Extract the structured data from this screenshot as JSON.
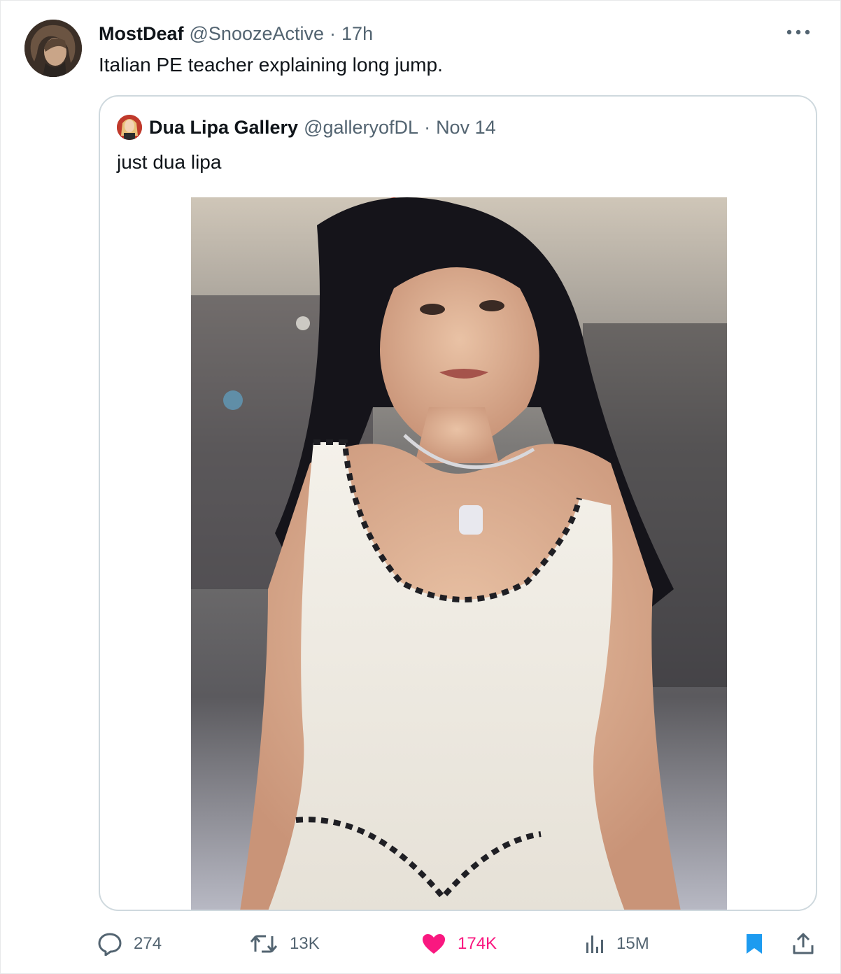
{
  "tweet": {
    "display_name": "MostDeaf",
    "handle": "@SnoozeActive",
    "separator": "·",
    "time": "17h",
    "text": "Italian PE teacher explaining long jump."
  },
  "quoted_tweet": {
    "display_name": "Dua Lipa Gallery",
    "handle": "@galleryofDL",
    "separator": "·",
    "time": "Nov 14",
    "text": "just dua lipa"
  },
  "actions": {
    "replies": "274",
    "retweets": "13K",
    "likes": "174K",
    "views": "15M"
  },
  "colors": {
    "like_active": "#f91880",
    "bookmark_active": "#1d9bf0",
    "muted_text": "#536471",
    "border": "#cfd9de"
  },
  "icons": [
    "more-icon",
    "reply-icon",
    "retweet-icon",
    "like-icon",
    "views-icon",
    "bookmark-icon",
    "share-icon"
  ]
}
